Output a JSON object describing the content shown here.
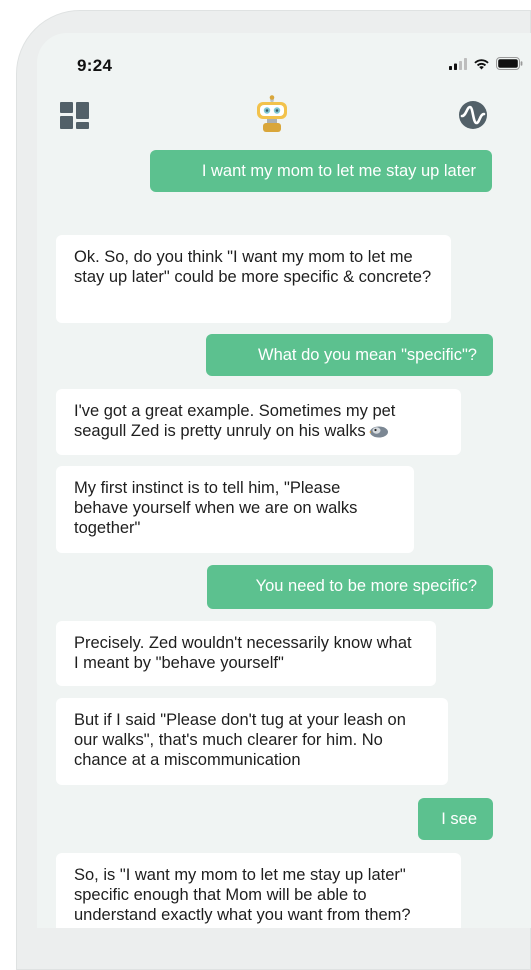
{
  "status_bar": {
    "time": "9:24"
  },
  "header": {
    "left_icon": "dashboard-grid-icon",
    "center_icon": "robot-avatar-icon",
    "right_icon": "waveform-icon"
  },
  "colors": {
    "user_bubble": "#5cc18f",
    "bot_bubble": "#ffffff",
    "screen_background": "#f0f4f3"
  },
  "messages": [
    {
      "sender": "user",
      "text": "I want my mom to let me stay up later"
    },
    {
      "sender": "bot",
      "text": "Ok. So, do you think \"I want my mom to let me stay up later\" could be more specific & concrete?"
    },
    {
      "sender": "user",
      "text": "What do you mean \"specific\"?"
    },
    {
      "sender": "bot",
      "text": "I've got a great example. Sometimes my pet seagull Zed is pretty unruly on his walks",
      "icon": "seagull-icon"
    },
    {
      "sender": "bot",
      "text": "My first instinct is to tell him, \"Please behave yourself when we are on walks together\""
    },
    {
      "sender": "user",
      "text": "You need to be more specific?"
    },
    {
      "sender": "bot",
      "text": "Precisely. Zed wouldn't necessarily know what I meant by \"behave yourself\""
    },
    {
      "sender": "bot",
      "text": "But if I said \"Please don't tug at your leash on our walks\", that's much clearer for him. No chance at a miscommunication"
    },
    {
      "sender": "user",
      "text": "I see"
    },
    {
      "sender": "bot",
      "text": "So, is \"I want my mom to let me stay up later\" specific enough that Mom will be able to understand exactly what you want from them?"
    }
  ]
}
